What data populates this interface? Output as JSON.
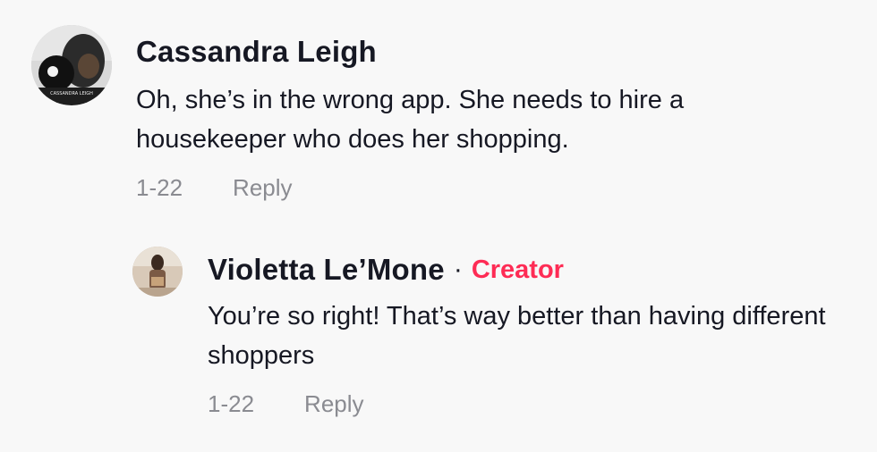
{
  "comments": [
    {
      "author": "Cassandra Leigh",
      "text": "Oh, she’s in the wrong app. She needs to hire a housekeeper who does her shopping.",
      "date": "1-22",
      "reply_label": "Reply",
      "avatar_text": "CASSANDRA LEIGH",
      "avatar_icon": "profile-photo"
    }
  ],
  "replies": [
    {
      "author": "Violetta Le’Mone",
      "separator": "·",
      "badge": "Creator",
      "text": "You’re so right! That’s way better than having different shoppers",
      "date": "1-22",
      "reply_label": "Reply",
      "avatar_icon": "profile-photo"
    }
  ],
  "colors": {
    "background": "#f8f8f8",
    "text": "#161823",
    "muted": "#8a8b91",
    "creator_badge": "#fe2c55"
  }
}
